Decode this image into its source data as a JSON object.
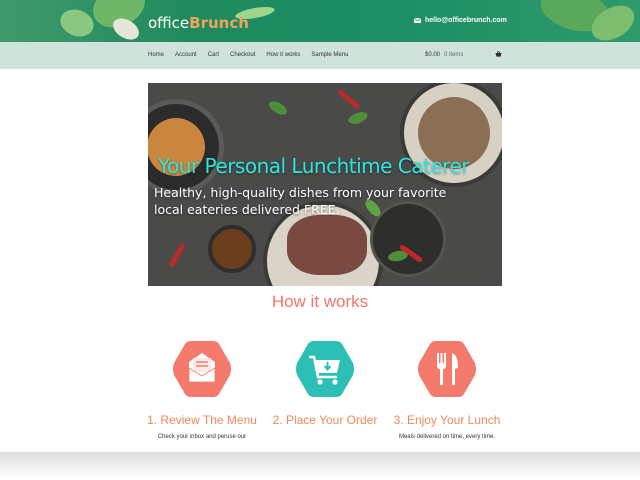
{
  "header": {
    "logo_part1": "office",
    "logo_part2": "Brunch",
    "email": "hello@officebrunch.com"
  },
  "nav": {
    "items": [
      {
        "label": "Home"
      },
      {
        "label": "Account"
      },
      {
        "label": "Cart"
      },
      {
        "label": "Checkout"
      },
      {
        "label": "How it works"
      },
      {
        "label": "Sample Menu"
      }
    ],
    "cart_total": "$0.00",
    "cart_items": "0 items"
  },
  "hero": {
    "title": "Your Personal Lunchtime Caterer",
    "subtitle": "Healthy, high-quality dishes from your favorite local eateries delivered FREE."
  },
  "how": {
    "title": "How it works",
    "steps": [
      {
        "label": "1. Review The Menu",
        "desc": "Check your inbox and peruse our",
        "icon": "envelope-icon",
        "color": "#f37a6d"
      },
      {
        "label": "2. Place Your Order",
        "desc": "",
        "icon": "cart-icon",
        "color": "#2bbfb5"
      },
      {
        "label": "3. Enjoy Your Lunch",
        "desc": "Meals delivered on time, every time.",
        "icon": "fork-knife-icon",
        "color": "#f37a6d"
      }
    ]
  },
  "colors": {
    "accent_coral": "#f37a6d",
    "accent_teal": "#2bbfb5",
    "hero_title": "#2ce6e0"
  }
}
